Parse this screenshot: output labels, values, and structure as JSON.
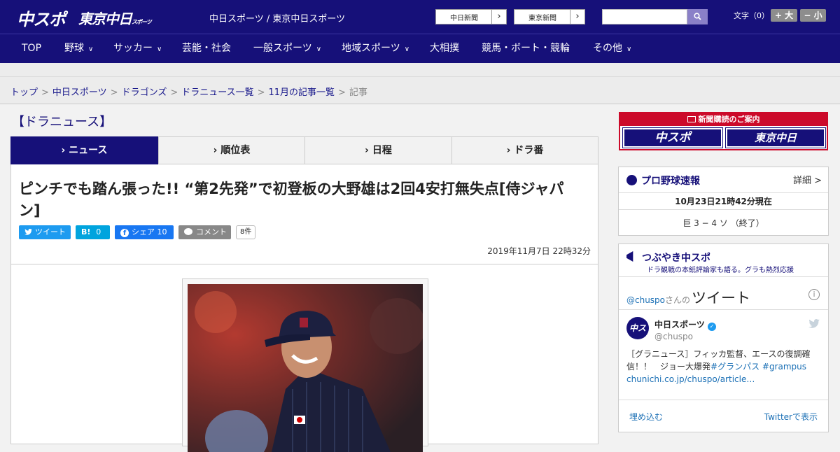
{
  "header": {
    "logo_main": "中スポ",
    "logo_tokyo": "東京中日",
    "logo_tokyo_small": "スポーツ",
    "site_link": "中日スポーツ / 東京中日スポーツ",
    "paper_btn_1": "中日新聞",
    "paper_btn_2": "東京新聞",
    "search_placeholder": "",
    "font_size_label": "文字（0）",
    "font_bigger": "+ 大",
    "font_smaller": "− 小"
  },
  "nav": {
    "items": [
      "TOP",
      "野球",
      "サッカー",
      "芸能・社会",
      "一般スポーツ",
      "地域スポーツ",
      "大相撲",
      "競馬・ボート・競輪",
      "その他"
    ]
  },
  "breadcrumb": {
    "items": [
      "トップ",
      "中日スポーツ",
      "ドラゴンズ",
      "ドラニュース一覧",
      "11月の記事一覧"
    ],
    "current": "記事",
    "separator": ">"
  },
  "section_title": "【ドラニュース】",
  "tabs": [
    "ニュース",
    "順位表",
    "日程",
    "ドラ番"
  ],
  "article": {
    "headline": "ピンチでも踏ん張った!! “第2先発”で初登板の大野雄は2回4安打無失点[侍ジャパン]",
    "tweet_label": "ツイート",
    "hatena_label": "B!",
    "hatena_count": "0",
    "facebook_label": "シェア",
    "facebook_count": "10",
    "comment_label": "コメント",
    "comment_count": "8件",
    "date": "2019年11月7日 22時32分"
  },
  "sidebar": {
    "subscribe_title": "新聞購読のご案内",
    "subscribe_logo_1": "中スポ",
    "subscribe_logo_2": "東京中日",
    "baseball": {
      "title": "プロ野球速報",
      "more": "詳細 >",
      "as_of": "10月23日21時42分現在",
      "score": "巨 3 − 4 ソ （終了）"
    },
    "tweets": {
      "title": "つぶやき中スポ",
      "subtitle": "ドラ観戦の本紙評論家も語る。グラも熱烈応援",
      "handle_prefix": "@chuspo",
      "handle_suffix": "さんの",
      "header_big": "ツイート",
      "avatar_text": "中スポ",
      "account_name": "中日スポーツ",
      "account_handle": "@chuspo",
      "text_plain": "［グラニュース］フィッカ監督、エースの復調確信！！　ジョー大爆発",
      "text_tags": "#グランパス #grampus",
      "text_link": "chunichi.co.jp/chuspo/article…",
      "embed": "埋め込む",
      "view_on_twitter": "Twitterで表示"
    }
  },
  "colors": {
    "brand_navy": "#161079",
    "accent_red": "#cc0a2a",
    "twitter_blue": "#1d9bf0",
    "facebook_blue": "#1877f2",
    "hatena_blue": "#00a4de"
  }
}
